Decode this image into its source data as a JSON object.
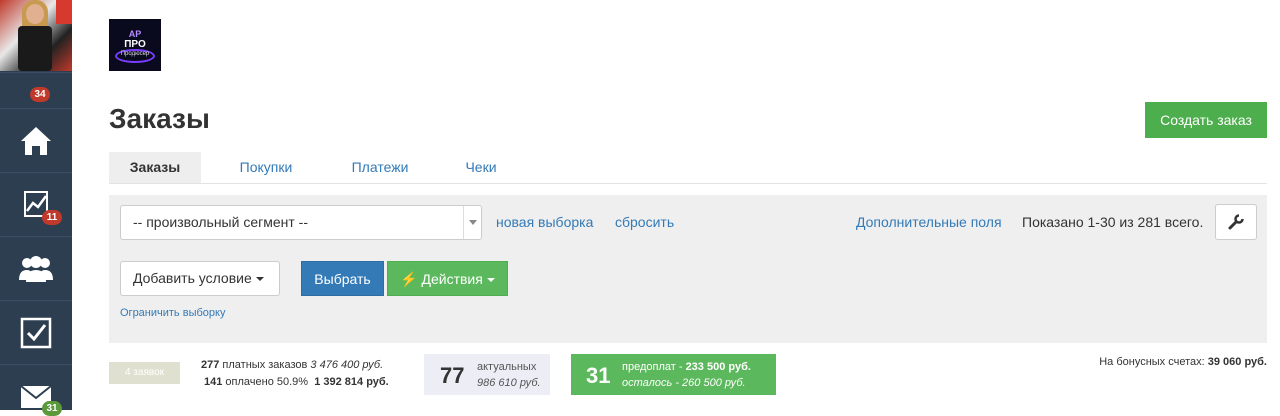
{
  "sidebar": {
    "badges": {
      "notifications": "34",
      "stats": "11",
      "messages": "31"
    }
  },
  "logo_text": {
    "line1": "АР",
    "line2": "ПРО",
    "line3": "Продюсер"
  },
  "page_title": "Заказы",
  "create_button": "Создать заказ",
  "tabs": [
    {
      "label": "Заказы"
    },
    {
      "label": "Покупки"
    },
    {
      "label": "Платежи"
    },
    {
      "label": "Чеки"
    }
  ],
  "filter": {
    "segment_value": "-- произвольный сегмент --",
    "new_selection": "новая выборка",
    "reset": "сбросить",
    "extra_fields": "Дополнительные поля",
    "shown": "Показано 1-30 из 281 всего.",
    "add_condition": "Добавить условие",
    "select_button": "Выбрать",
    "actions_button": "Действия",
    "limit_link": "Ограничить выборку"
  },
  "stats": {
    "count_pill": "4 заявок",
    "paid_count": "277",
    "paid_label": "платных заказов",
    "paid_sum": "3 476 400 руб.",
    "paid_done_count": "141",
    "paid_done_label": "оплачено 50.9%",
    "paid_done_sum": "1 392 814 руб.",
    "actual_count": "77",
    "actual_label": "актуальных",
    "actual_sum": "986 610 руб.",
    "prepay_count": "31",
    "prepay_label": "предоплат -",
    "prepay_sum": "233 500 руб.",
    "remain_label": "осталось -",
    "remain_sum": "260 500 руб.",
    "bonus_label": "На бонусных счетах:",
    "bonus_value": "39 060 руб."
  },
  "colors": {
    "sidebar": "#2c3e50",
    "primary": "#337ab7",
    "success": "#5cb85c",
    "badge": "#c0392b"
  }
}
